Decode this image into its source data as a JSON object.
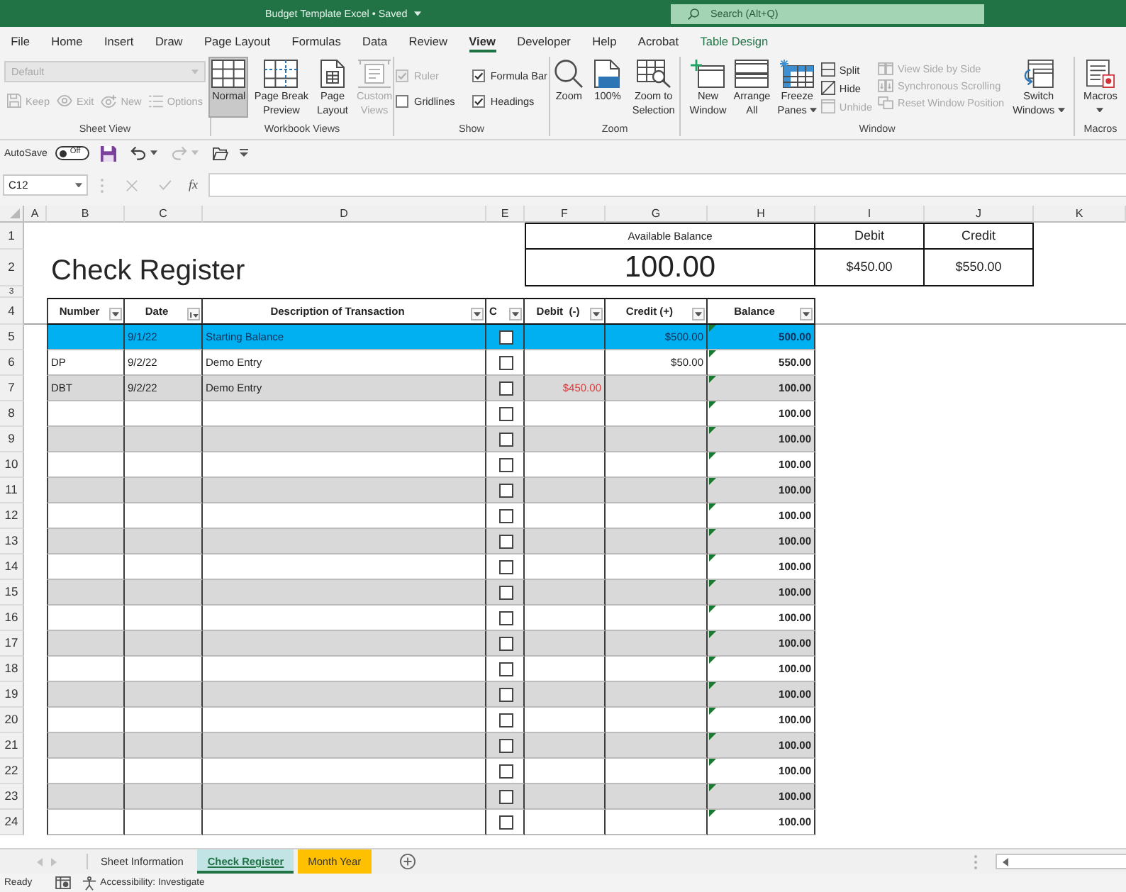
{
  "window": {
    "title": "Budget Template Excel • Saved",
    "search": {
      "placeholder": "Search (Alt+Q)"
    }
  },
  "ribbon_tabs": [
    {
      "label": "File",
      "kind": "standard",
      "selected": false
    },
    {
      "label": "Home",
      "kind": "standard",
      "selected": false
    },
    {
      "label": "Insert",
      "kind": "standard",
      "selected": false
    },
    {
      "label": "Draw",
      "kind": "standard",
      "selected": false
    },
    {
      "label": "Page Layout",
      "kind": "standard",
      "selected": false
    },
    {
      "label": "Formulas",
      "kind": "standard",
      "selected": false
    },
    {
      "label": "Data",
      "kind": "standard",
      "selected": false
    },
    {
      "label": "Review",
      "kind": "standard",
      "selected": false
    },
    {
      "label": "View",
      "kind": "standard",
      "selected": true
    },
    {
      "label": "Developer",
      "kind": "standard",
      "selected": false
    },
    {
      "label": "Help",
      "kind": "standard",
      "selected": false
    },
    {
      "label": "Acrobat",
      "kind": "standard",
      "selected": false
    },
    {
      "label": "Table Design",
      "kind": "contextual",
      "selected": false
    }
  ],
  "ribbon": {
    "groups": [
      {
        "label": "Sheet View",
        "stacks": [
          [
            {
              "kind": "dropdown",
              "label": "Default",
              "disabled": true
            }
          ],
          [
            {
              "kind": "small",
              "label": "Keep",
              "disabled": true
            },
            {
              "kind": "small",
              "label": "Exit",
              "disabled": true
            },
            {
              "kind": "small",
              "label": "New",
              "disabled": true
            },
            {
              "kind": "small",
              "label": "Options",
              "disabled": true
            }
          ]
        ]
      },
      {
        "label": "Workbook Views",
        "stacks": [
          [
            {
              "kind": "large",
              "lines": [
                "Normal"
              ],
              "selected": true,
              "disabled": false
            }
          ],
          [
            {
              "kind": "large",
              "lines": [
                "Page Break",
                "Preview"
              ],
              "selected": false,
              "disabled": false
            }
          ],
          [
            {
              "kind": "large",
              "lines": [
                "Page",
                "Layout"
              ],
              "selected": false,
              "disabled": false
            }
          ],
          [
            {
              "kind": "large",
              "lines": [
                "Custom",
                "Views"
              ],
              "selected": false,
              "disabled": true
            }
          ]
        ]
      },
      {
        "label": "Show",
        "stacks": [
          [
            {
              "kind": "check",
              "label": "Ruler",
              "checked": true,
              "disabled": true
            },
            {
              "kind": "check",
              "label": "Gridlines",
              "checked": false,
              "disabled": false
            }
          ],
          [
            {
              "kind": "check",
              "label": "Formula Bar",
              "checked": true,
              "disabled": false
            },
            {
              "kind": "check",
              "label": "Headings",
              "checked": true,
              "disabled": false
            }
          ]
        ]
      },
      {
        "label": "Zoom",
        "stacks": [
          [
            {
              "kind": "large",
              "lines": [
                "Zoom"
              ],
              "disabled": false
            }
          ],
          [
            {
              "kind": "large",
              "lines": [
                "100%"
              ],
              "disabled": false
            }
          ],
          [
            {
              "kind": "large",
              "lines": [
                "Zoom to",
                "Selection"
              ],
              "disabled": false
            }
          ]
        ]
      },
      {
        "label": "Window",
        "stacks": [
          [
            {
              "kind": "large",
              "lines": [
                "New",
                "Window"
              ],
              "disabled": false
            }
          ],
          [
            {
              "kind": "large",
              "lines": [
                "Arrange",
                "All"
              ],
              "disabled": false
            }
          ],
          [
            {
              "kind": "large",
              "lines": [
                "Freeze",
                "Panes"
              ],
              "caret": true,
              "disabled": false
            }
          ],
          [
            {
              "kind": "small",
              "label": "Split",
              "disabled": false
            },
            {
              "kind": "small",
              "label": "Hide",
              "disabled": false
            },
            {
              "kind": "small",
              "label": "Unhide",
              "disabled": true
            }
          ],
          [
            {
              "kind": "small",
              "label": "View Side by Side",
              "disabled": true
            },
            {
              "kind": "small",
              "label": "Synchronous Scrolling",
              "disabled": true
            },
            {
              "kind": "small",
              "label": "Reset Window Position",
              "disabled": true
            }
          ],
          [
            {
              "kind": "large",
              "lines": [
                "Switch",
                "Windows"
              ],
              "caret": true,
              "disabled": false
            }
          ]
        ]
      },
      {
        "label": "Macros",
        "stacks": [
          [
            {
              "kind": "large",
              "lines": [
                "Macros"
              ],
              "caret": true,
              "disabled": false
            }
          ]
        ]
      }
    ]
  },
  "quick_access": {
    "autosave": {
      "label": "AutoSave",
      "on": false,
      "state_text": "Off"
    },
    "tools": [
      {
        "disabled": false
      },
      {
        "disabled": false,
        "caret": true
      },
      {
        "disabled": true,
        "caret": true
      },
      {
        "disabled": false
      }
    ]
  },
  "formula_bar": {
    "name_box": "C12",
    "function_button": "fx"
  },
  "sheet": {
    "columns": [
      "A",
      "B",
      "C",
      "D",
      "E",
      "F",
      "G",
      "H",
      "I",
      "J",
      "K"
    ],
    "row_numbers": [
      "1",
      "2",
      "3",
      "4",
      "5",
      "6",
      "7",
      "8",
      "9",
      "10",
      "11",
      "12",
      "13",
      "14",
      "15",
      "16",
      "17",
      "18",
      "19",
      "20",
      "21",
      "22",
      "23",
      "24"
    ],
    "title": "Check Register",
    "summary": {
      "available_label": "Available Balance",
      "available": "100.00",
      "debit_label": "Debit",
      "debit": "$450.00",
      "credit_label": "Credit",
      "credit": "$550.00"
    },
    "table": {
      "headers": [
        {
          "label": "Number",
          "sorted": false
        },
        {
          "label": "Date",
          "sorted": true
        },
        {
          "label": "Description of Transaction",
          "sorted": false
        },
        {
          "label": "C",
          "sorted": false
        },
        {
          "label": "Debit  (-)",
          "sorted": false
        },
        {
          "label": "Credit (+)",
          "sorted": false
        },
        {
          "label": "Balance",
          "sorted": false
        }
      ],
      "rows": [
        {
          "date": "9/1/22",
          "description": "Starting Balance",
          "cleared": false,
          "credit": "$500.00",
          "balance": "500.00",
          "selected": true,
          "flagged": true
        },
        {
          "number": "DP",
          "date": "9/2/22",
          "description": "Demo Entry",
          "cleared": false,
          "credit": "$50.00",
          "balance": "550.00",
          "selected": false,
          "flagged": true
        },
        {
          "number": "DBT",
          "date": "9/2/22",
          "description": "Demo Entry",
          "cleared": false,
          "debit": "$450.00",
          "balance": "100.00",
          "selected": false,
          "flagged": true
        },
        {
          "cleared": false,
          "balance": "100.00",
          "selected": false,
          "flagged": true
        },
        {
          "cleared": false,
          "balance": "100.00",
          "selected": false,
          "flagged": true
        },
        {
          "cleared": false,
          "balance": "100.00",
          "selected": false,
          "flagged": true
        },
        {
          "cleared": false,
          "balance": "100.00",
          "selected": false,
          "flagged": true
        },
        {
          "cleared": false,
          "balance": "100.00",
          "selected": false,
          "flagged": true
        },
        {
          "cleared": false,
          "balance": "100.00",
          "selected": false,
          "flagged": true
        },
        {
          "cleared": false,
          "balance": "100.00",
          "selected": false,
          "flagged": true
        },
        {
          "cleared": false,
          "balance": "100.00",
          "selected": false,
          "flagged": true
        },
        {
          "cleared": false,
          "balance": "100.00",
          "selected": false,
          "flagged": true
        },
        {
          "cleared": false,
          "balance": "100.00",
          "selected": false,
          "flagged": true
        },
        {
          "cleared": false,
          "balance": "100.00",
          "selected": false,
          "flagged": true
        },
        {
          "cleared": false,
          "balance": "100.00",
          "selected": false,
          "flagged": true
        },
        {
          "cleared": false,
          "balance": "100.00",
          "selected": false,
          "flagged": true
        },
        {
          "cleared": false,
          "balance": "100.00",
          "selected": false,
          "flagged": true
        },
        {
          "cleared": false,
          "balance": "100.00",
          "selected": false,
          "flagged": true
        },
        {
          "cleared": false,
          "balance": "100.00",
          "selected": false,
          "flagged": true
        },
        {
          "cleared": false,
          "balance": "100.00",
          "selected": false,
          "flagged": true
        }
      ]
    }
  },
  "sheet_tabs": [
    {
      "label": "Sheet Information",
      "selected": false
    },
    {
      "label": "Check Register",
      "selected": true,
      "color": "#c2e4e4"
    },
    {
      "label": "Month Year",
      "selected": false,
      "color": "#ffc000"
    }
  ],
  "status_bar": {
    "mode": "Ready",
    "accessibility": "Accessibility: Investigate"
  }
}
